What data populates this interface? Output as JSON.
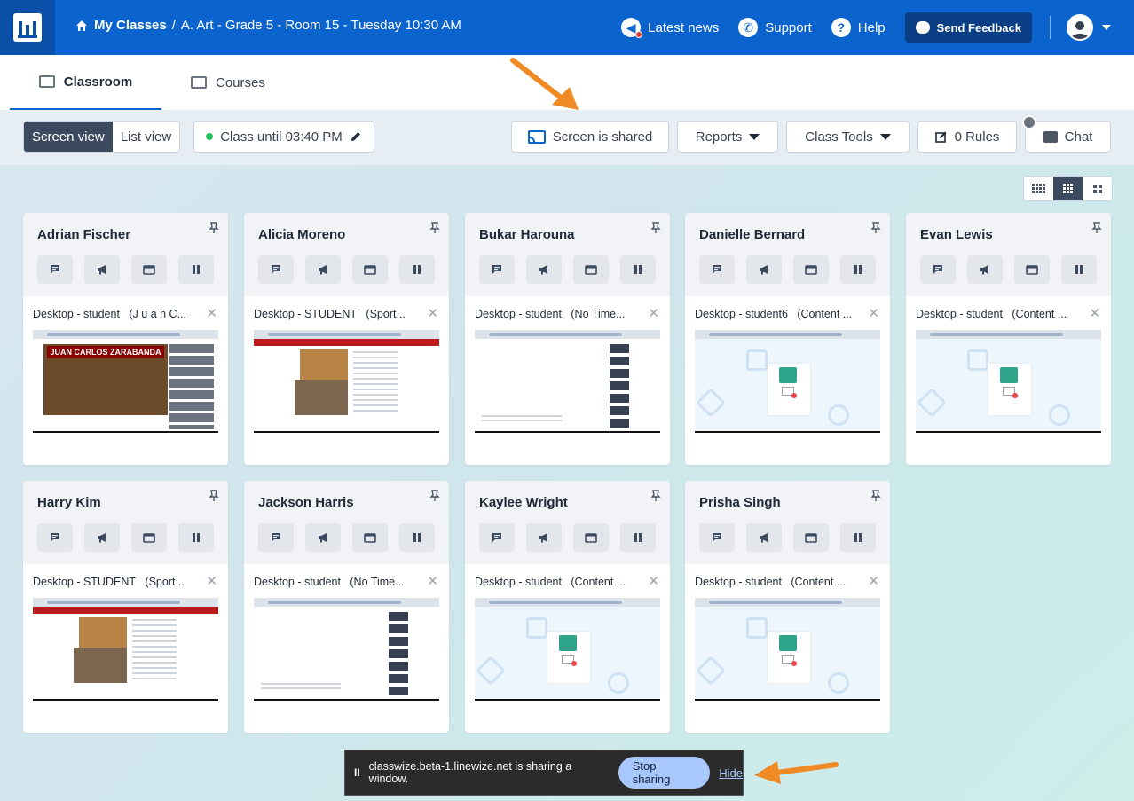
{
  "header": {
    "breadcrumb_root": "My Classes",
    "breadcrumb_sep": "/",
    "breadcrumb_current": "A. Art - Grade 5 - Room 15 - Tuesday 10:30 AM",
    "nav": {
      "news": "Latest news",
      "support": "Support",
      "help": "Help",
      "feedback": "Send Feedback"
    }
  },
  "tabs": {
    "classroom": "Classroom",
    "courses": "Courses"
  },
  "toolbar": {
    "screen_view": "Screen view",
    "list_view": "List view",
    "class_until": "Class until 03:40 PM",
    "screen_shared": "Screen is shared",
    "reports": "Reports",
    "class_tools": "Class Tools",
    "rules": "0 Rules",
    "chat": "Chat"
  },
  "students": [
    {
      "name": "Adrian Fischer",
      "device": "Desktop - student",
      "title": "(J u a n C...",
      "thumb": "video",
      "video_banner": "JUAN CARLOS ZARABANDA"
    },
    {
      "name": "Alicia Moreno",
      "device": "Desktop - STUDENT",
      "title": "(Sport...",
      "thumb": "sport"
    },
    {
      "name": "Bukar Harouna",
      "device": "Desktop - student",
      "title": "(No Time...",
      "thumb": "yt"
    },
    {
      "name": "Danielle Bernard",
      "device": "Desktop - student6",
      "title": "(Content ...",
      "thumb": "block"
    },
    {
      "name": "Evan Lewis",
      "device": "Desktop - student",
      "title": "(Content ...",
      "thumb": "block"
    },
    {
      "name": "Harry Kim",
      "device": "Desktop - STUDENT",
      "title": "(Sport...",
      "thumb": "sport"
    },
    {
      "name": "Jackson Harris",
      "device": "Desktop - student",
      "title": "(No Time...",
      "thumb": "yt"
    },
    {
      "name": "Kaylee Wright",
      "device": "Desktop - student",
      "title": "(Content ...",
      "thumb": "block"
    },
    {
      "name": "Prisha Singh",
      "device": "Desktop - student",
      "title": "(Content ...",
      "thumb": "block"
    }
  ],
  "share_bar": {
    "pause": "II",
    "message": "classwize.beta-1.linewize.net is sharing a window.",
    "stop": "Stop sharing",
    "hide": "Hide"
  },
  "colors": {
    "brand": "#0b63ce",
    "annotation_arrow": "#f08a24"
  }
}
